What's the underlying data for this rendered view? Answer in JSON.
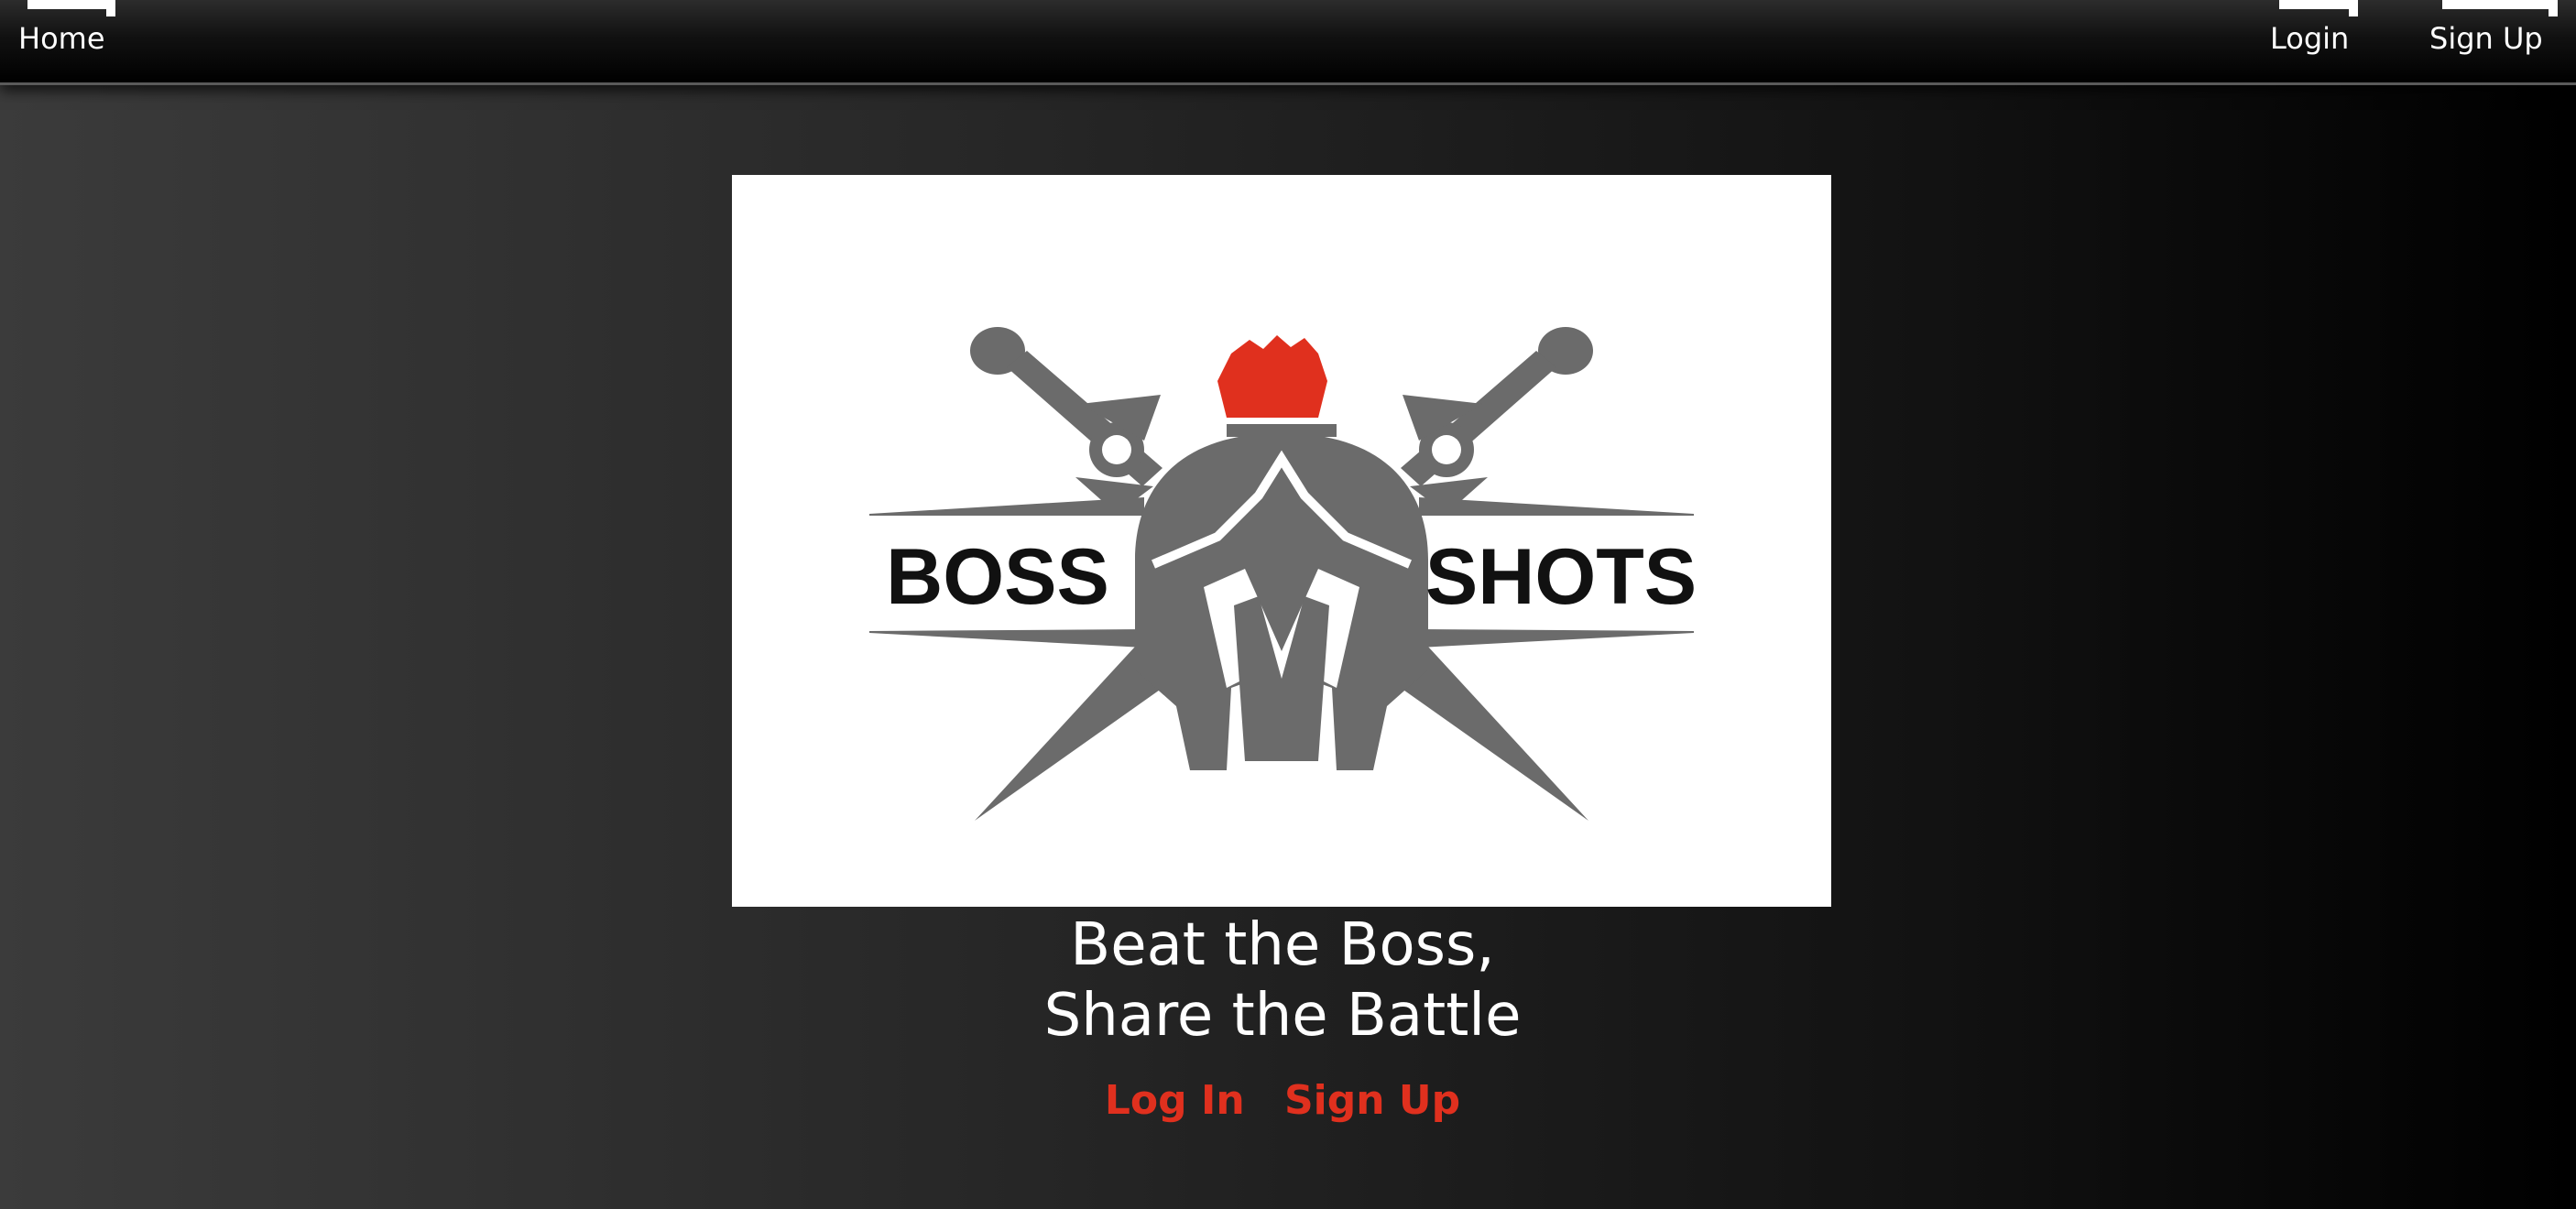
{
  "nav": {
    "home_label": "Home",
    "login_label": "Login",
    "signup_label": "Sign Up"
  },
  "logo": {
    "word_left": "BOSS",
    "word_right": "SHOTS",
    "colors": {
      "helmet": "#6b6b6b",
      "crest": "#e0301e",
      "text": "#111111",
      "background": "#ffffff"
    }
  },
  "hero": {
    "tagline_line1": "Beat the Boss,",
    "tagline_line2": "Share the Battle"
  },
  "cta": {
    "login_label": "Log In",
    "signup_label": "Sign Up",
    "link_color": "#e0301e"
  }
}
